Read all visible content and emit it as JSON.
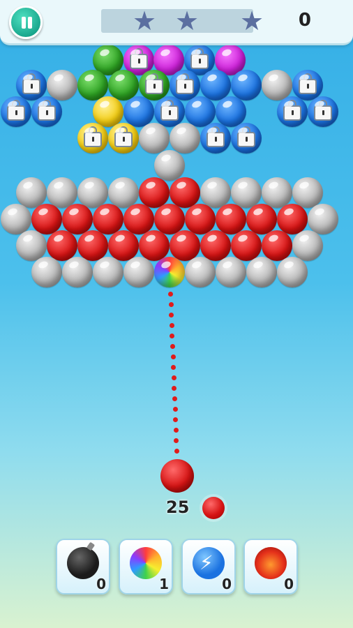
{
  "hud": {
    "score": "0",
    "stars_total": 3,
    "stars_earned": 0,
    "icons": {
      "pause": "pause-icon",
      "star": "star-icon"
    }
  },
  "board": {
    "colors": {
      "red": "#d61414",
      "gray": "#b4b4b4",
      "green": "#2ea223",
      "blue": "#1b72e0",
      "purple": "#cc22d8",
      "yellow": "#f2cc12"
    },
    "upper_cluster": [
      [
        "green",
        "purple-locked",
        "purple",
        "blue-locked",
        "purple"
      ],
      [
        "blue-locked",
        "gray",
        "green",
        "green",
        "green-locked",
        "blue-locked",
        "blue",
        "blue",
        "gray",
        "blue-locked"
      ],
      [
        "blue-locked",
        "blue-locked",
        "yellow",
        "blue",
        "blue-locked",
        "blue",
        "blue",
        "blue-locked",
        "blue-locked"
      ],
      [
        "yellow-locked",
        "yellow-locked",
        "gray",
        "gray",
        "blue-locked",
        "blue-locked"
      ],
      [
        "gray"
      ]
    ],
    "lower_cluster": [
      [
        "gray",
        "gray",
        "gray",
        "gray",
        "red",
        "red",
        "gray",
        "gray",
        "gray",
        "gray"
      ],
      [
        "gray",
        "red",
        "red",
        "red",
        "red",
        "red",
        "red",
        "red",
        "red",
        "red",
        "gray"
      ],
      [
        "gray",
        "red",
        "red",
        "red",
        "red",
        "red",
        "red",
        "red",
        "red",
        "gray"
      ],
      [
        "gray",
        "gray",
        "gray",
        "gray",
        "rainbow",
        "gray",
        "gray",
        "gray",
        "gray"
      ]
    ]
  },
  "shooter": {
    "current_color": "red",
    "next_color": "red",
    "moves_left": "25"
  },
  "boosters": [
    {
      "name": "bomb",
      "icon": "bomb-icon",
      "count": "0"
    },
    {
      "name": "rainbow",
      "icon": "rainbow-ball-icon",
      "count": "1"
    },
    {
      "name": "lightning",
      "icon": "lightning-ball-icon",
      "count": "0"
    },
    {
      "name": "fireball",
      "icon": "fireball-icon",
      "count": "0"
    }
  ]
}
